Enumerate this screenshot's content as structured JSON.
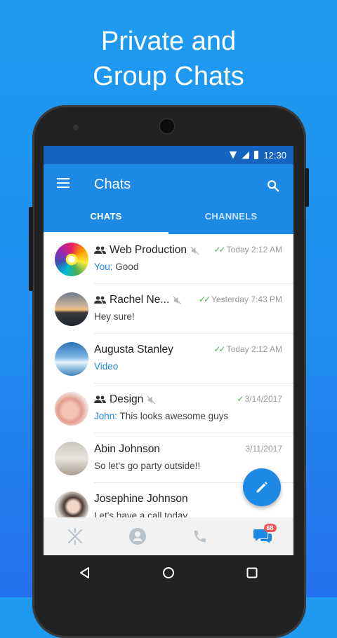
{
  "promo": {
    "line1": "Private and",
    "line2": "Group Chats"
  },
  "status_bar": {
    "time": "12:30"
  },
  "app_bar": {
    "title": "Chats"
  },
  "tabs": [
    {
      "label": "CHATS",
      "active": true
    },
    {
      "label": "CHANNELS",
      "active": false
    }
  ],
  "chats": [
    {
      "name": "Web Production",
      "group": true,
      "muted": true,
      "time": "Today 2:12 AM",
      "read": "double",
      "sender": "You:",
      "message": " Good",
      "avatar": "flower"
    },
    {
      "name": "Rachel Ne...",
      "group": true,
      "muted": true,
      "time": "Yesterday 7:43 PM",
      "read": "double",
      "sender": "",
      "message": "Hey sure!",
      "avatar": "sunset"
    },
    {
      "name": "Augusta Stanley",
      "group": false,
      "muted": false,
      "time": "Today 2:12 AM",
      "read": "double",
      "sender": "",
      "message": "Video",
      "media": true,
      "avatar": "sea"
    },
    {
      "name": "Design",
      "group": true,
      "muted": true,
      "time": "3/14/2017",
      "read": "single",
      "sender": "John:",
      "message": " This looks awesome guys",
      "avatar": "hands"
    },
    {
      "name": "Abin Johnson",
      "group": false,
      "muted": false,
      "time": "3/11/2017",
      "read": "none",
      "sender": "",
      "message": "So let's go party outside!!",
      "avatar": "room"
    },
    {
      "name": "Josephine Johnson",
      "group": false,
      "muted": false,
      "time": "",
      "read": "none",
      "sender": "",
      "message": "Let's have a call today",
      "avatar": "woman"
    }
  ],
  "bottom_nav": {
    "items": [
      "logo-icon",
      "contacts-icon",
      "calls-icon",
      "chats-icon"
    ],
    "badge": "68"
  },
  "colors": {
    "primary": "#1e88e5",
    "status_bar": "#1565c0",
    "accent_check": "#4caf50",
    "badge": "#f45b5b"
  }
}
